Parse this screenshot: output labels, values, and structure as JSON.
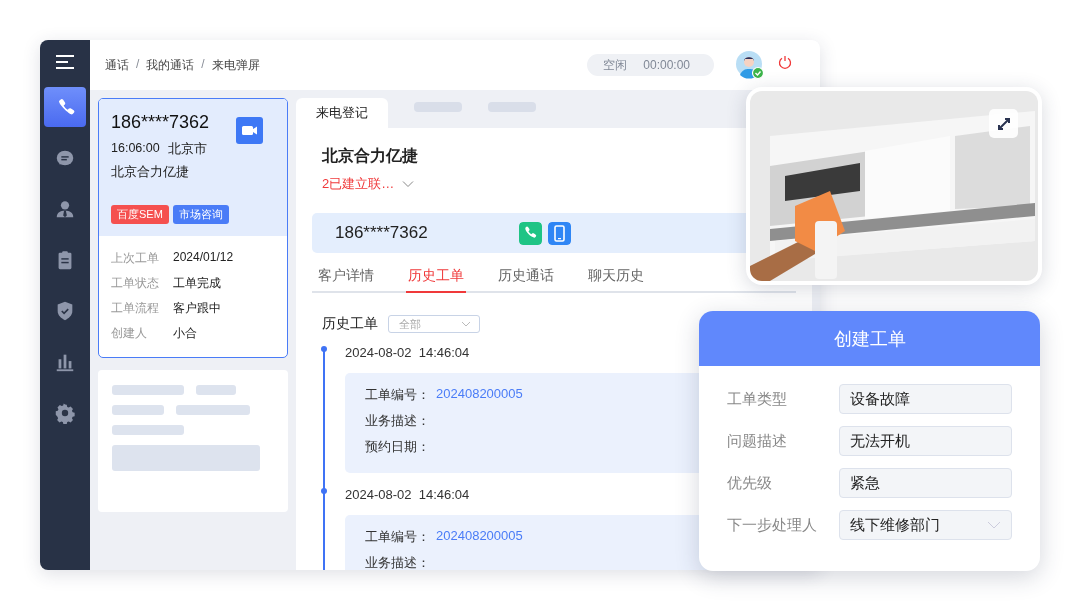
{
  "sidebar": {
    "items": [
      {
        "selected": true
      },
      {
        "selected": false
      },
      {
        "selected": false
      },
      {
        "selected": false
      },
      {
        "selected": false
      },
      {
        "selected": false
      },
      {
        "selected": false
      }
    ]
  },
  "breadcrumb": [
    {
      "kind": "crumb",
      "text": "通话"
    },
    {
      "kind": "separator",
      "text": "/"
    },
    {
      "kind": "crumb",
      "text": "我的通话"
    },
    {
      "kind": "separator",
      "text": "/"
    },
    {
      "kind": "crumb",
      "text": "来电弹屏"
    }
  ],
  "status": {
    "state": "空闲",
    "timer": "00:00:00"
  },
  "user": {
    "online": true
  },
  "caller_card": {
    "phone": "186****7362",
    "time": "16:06:00",
    "city": "北京市",
    "company": "北京合力亿捷",
    "tags": [
      {
        "label": "百度SEM",
        "color": "#f5504f"
      },
      {
        "label": "市场咨询",
        "color": "#4a7cf7"
      }
    ],
    "details": [
      {
        "label": "上次工单",
        "value": "2024/01/12"
      },
      {
        "label": "工单状态",
        "value": "工单完成"
      },
      {
        "label": "工单流程",
        "value": "客户跟中"
      },
      {
        "label": "创建人",
        "value": "小合"
      }
    ]
  },
  "tabs": [
    {
      "label": "来电登记",
      "selected": true
    }
  ],
  "customer": {
    "name": "北京合力亿捷",
    "contacts": "2已建立联…",
    "phone": "186****7362"
  },
  "sub_tabs": [
    {
      "label": "客户详情",
      "selected": false
    },
    {
      "label": "历史工单",
      "selected": true
    },
    {
      "label": "历史通话",
      "selected": false
    },
    {
      "label": "聊天历史",
      "selected": false
    }
  ],
  "history": {
    "title": "历史工单",
    "filter": "全部",
    "entries": [
      {
        "date": "2024-08-02  14:46:04",
        "fields": [
          {
            "label": "工单编号：",
            "value": "202408200005"
          },
          {
            "label": "业务描述："
          },
          {
            "label": "预约日期："
          }
        ]
      },
      {
        "date": "2024-08-02  14:46:04",
        "fields": [
          {
            "label": "工单编号：",
            "value": "202408200005"
          },
          {
            "label": "业务描述："
          }
        ]
      }
    ]
  },
  "form": {
    "title": "创建工单",
    "fields": [
      {
        "label": "工单类型",
        "value": "设备故障",
        "kind": "input"
      },
      {
        "label": "问题描述",
        "value": "无法开机",
        "kind": "input"
      },
      {
        "label": "优先级",
        "value": "紧急",
        "kind": "input"
      },
      {
        "label": "下一步处理人",
        "value": "线下维修部门",
        "kind": "select"
      }
    ]
  }
}
